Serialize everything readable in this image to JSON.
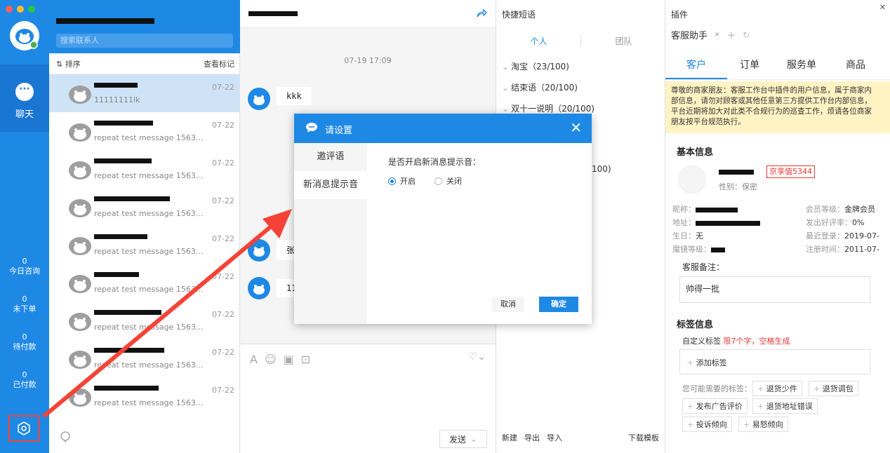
{
  "nav": {
    "window_dot_colors": [
      "#ff5f57",
      "#febc2e",
      "#28c840"
    ],
    "chat_label": "聊天",
    "stats": [
      {
        "value": "0",
        "label": "今日咨询"
      },
      {
        "value": "0",
        "label": "未下单"
      },
      {
        "value": "0",
        "label": "待付款"
      },
      {
        "value": "0",
        "label": "已付款"
      }
    ]
  },
  "contacts": {
    "search_placeholder": "搜索联系人",
    "sort_label": "排序",
    "view_marks": "查看标记",
    "rows": [
      {
        "preview": "11111111lk",
        "date": "07-22"
      },
      {
        "preview": "repeat test message 1563...",
        "date": "07-22"
      },
      {
        "preview": "repeat test message 1563...",
        "date": "07-22"
      },
      {
        "preview": "repeat test message 1563...",
        "date": "07-22"
      },
      {
        "preview": "repeat test message 1563...",
        "date": "07-22"
      },
      {
        "preview": "repeat test message 1563...",
        "date": "07-22"
      },
      {
        "preview": "repeat test message 1563...",
        "date": "07-22"
      },
      {
        "preview": "repeat test message 1563...",
        "date": "07-22"
      },
      {
        "preview": "repeat test message 1563...",
        "date": "07-22"
      }
    ]
  },
  "chat": {
    "timestamp": "07-19 17:09",
    "messages": [
      "kkk",
      "张",
      "11"
    ],
    "send_label": "发送"
  },
  "quick": {
    "title": "快捷短语",
    "tabs": [
      "个人",
      "团队"
    ],
    "groups": [
      "淘宝（23/100)",
      "结束语（20/100)",
      "双十一说明（20/100)",
      "100)"
    ],
    "footer": {
      "new": "新建",
      "export": "导出",
      "import": "导入",
      "download": "下载模板"
    }
  },
  "plugin": {
    "title": "插件",
    "tab_label": "客服助手",
    "subtabs": [
      "客户",
      "订单",
      "服务单",
      "商品"
    ],
    "notice": "尊敬的商家朋友：客服工作台中插件的用户信息，属于商家内部信息，请勿对顾客或其他任意第三方提供工作台内部信息，平台近期将加大对此类不合规行为的巡查工作，烦请各位商家朋友按平台规范执行。",
    "basic_info_title": "基本信息",
    "jingxiang_badge": "京享值5344",
    "gender": "性别：保密",
    "fields": {
      "nickname_label": "昵称：",
      "address_label": "地址：",
      "birthday_label": "生日：",
      "birthday_value": "无",
      "mojing_label": "魔镜等级：",
      "member_label": "会员等级：",
      "member_value": "金牌会员",
      "rating_label": "发出好评率：",
      "rating_value": "0%",
      "last_login_label": "最近登录：",
      "last_login_value": "2019-07-",
      "register_label": "注册时间：",
      "register_value": "2011-07-"
    },
    "note_label": "客服备注：",
    "note_value": "帅得一批",
    "tag_title": "标签信息",
    "custom_tag_label": "自定义标签",
    "custom_tag_hint": "限7个字，空格生成",
    "add_tag": "添加标签",
    "suggest_label": "您可能需要的标签：",
    "suggested_tags": [
      "退货少件",
      "退货调包",
      "发布广告评价",
      "退货地址错误",
      "投诉倾向",
      "易怒倾向"
    ]
  },
  "dialog": {
    "title": "请设置",
    "side_items": [
      "邀评语",
      "新消息提示音"
    ],
    "question": "是否开启新消息提示音：",
    "options": [
      "开启",
      "关闭"
    ],
    "selected": "开启",
    "cancel": "取消",
    "confirm": "确定"
  },
  "colors": {
    "primary": "#1e88e5",
    "annotation_red": "#f44336",
    "badge_red": "#e53935"
  }
}
